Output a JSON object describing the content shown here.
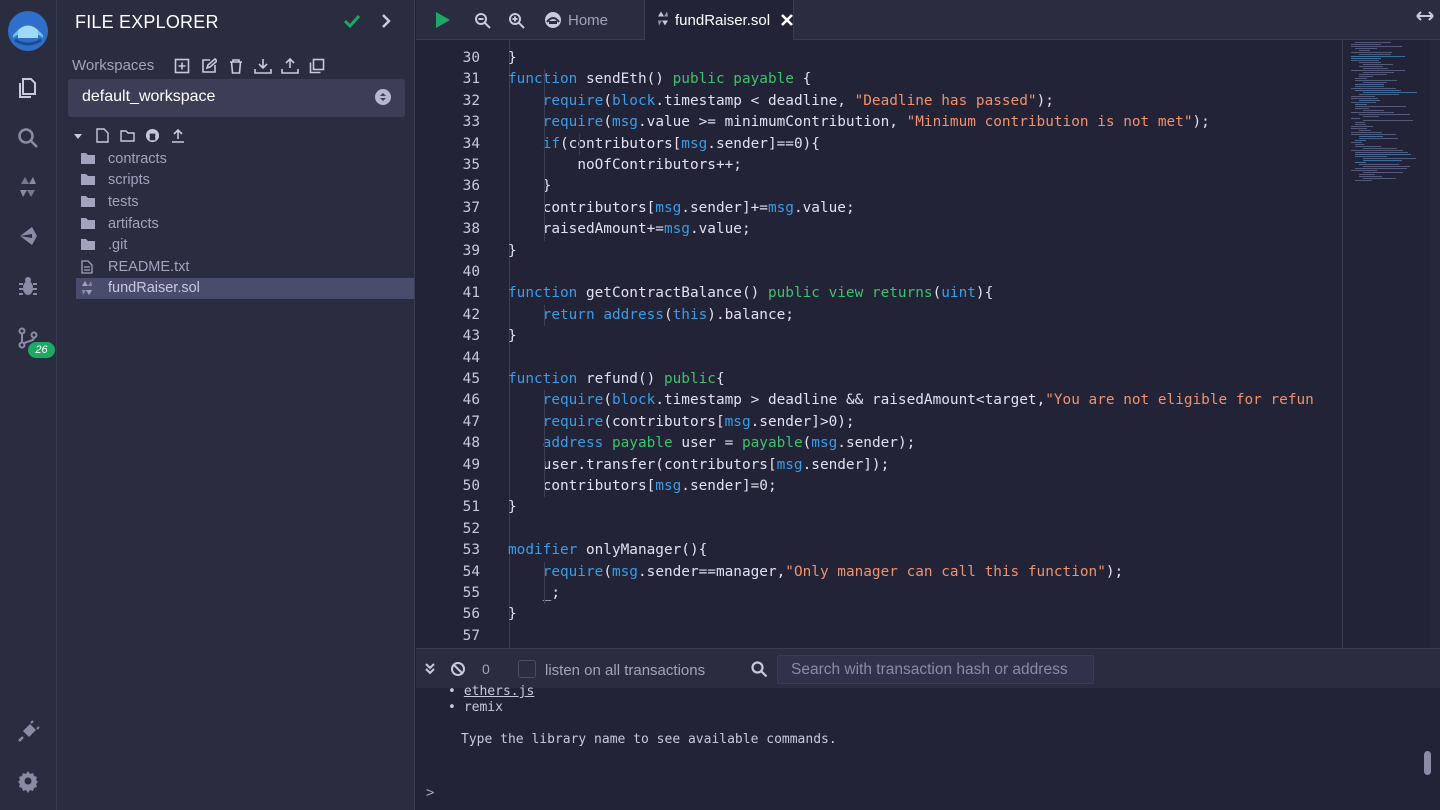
{
  "rail": {
    "items": [
      {
        "name": "file-explorer",
        "icon": "files-icon"
      },
      {
        "name": "search",
        "icon": "search-icon"
      },
      {
        "name": "solidity-compiler",
        "icon": "solidity-icon"
      },
      {
        "name": "deploy-run",
        "icon": "ethereum-icon"
      },
      {
        "name": "debugger",
        "icon": "bug-icon"
      },
      {
        "name": "git",
        "icon": "git-branch-icon"
      },
      {
        "name": "plugin-manager",
        "icon": "plug-icon"
      },
      {
        "name": "settings",
        "icon": "gear-icon"
      }
    ],
    "git_badge": "26"
  },
  "explorer": {
    "title": "FILE EXPLORER",
    "workspaces_label": "Workspaces",
    "workspace_selected": "default_workspace",
    "tree": [
      {
        "label": "contracts",
        "type": "folder"
      },
      {
        "label": "scripts",
        "type": "folder"
      },
      {
        "label": "tests",
        "type": "folder"
      },
      {
        "label": "artifacts",
        "type": "folder"
      },
      {
        "label": ".git",
        "type": "folder"
      },
      {
        "label": "README.txt",
        "type": "file"
      },
      {
        "label": "fundRaiser.sol",
        "type": "sol",
        "active": true
      }
    ]
  },
  "tabs": {
    "home": "Home",
    "file": "fundRaiser.sol"
  },
  "code": {
    "lines": [
      {
        "n": "30",
        "text": "    }"
      },
      {
        "n": "31",
        "text": "    function sendEth() public payable {"
      },
      {
        "n": "32",
        "text": "        require(block.timestamp < deadline, \"Deadline has passed\");"
      },
      {
        "n": "33",
        "text": "        require(msg.value >= minimumContribution, \"Minimum contribution is not met\");"
      },
      {
        "n": "34",
        "text": "        if(contributors[msg.sender]==0){"
      },
      {
        "n": "35",
        "text": "            noOfContributors++;"
      },
      {
        "n": "36",
        "text": "        }"
      },
      {
        "n": "37",
        "text": "        contributors[msg.sender]+=msg.value;"
      },
      {
        "n": "38",
        "text": "        raisedAmount+=msg.value;"
      },
      {
        "n": "39",
        "text": "    }"
      },
      {
        "n": "40",
        "text": ""
      },
      {
        "n": "41",
        "text": "    function getContractBalance() public view returns(uint){"
      },
      {
        "n": "42",
        "text": "        return address(this).balance;"
      },
      {
        "n": "43",
        "text": "    }"
      },
      {
        "n": "44",
        "text": ""
      },
      {
        "n": "45",
        "text": "    function refund() public{"
      },
      {
        "n": "46",
        "text": "        require(block.timestamp > deadline && raisedAmount<target,\"You are not eligible for refun"
      },
      {
        "n": "47",
        "text": "        require(contributors[msg.sender]>0);"
      },
      {
        "n": "48",
        "text": "        address payable user = payable(msg.sender);"
      },
      {
        "n": "49",
        "text": "        user.transfer(contributors[msg.sender]);"
      },
      {
        "n": "50",
        "text": "        contributors[msg.sender]=0;"
      },
      {
        "n": "51",
        "text": "    }"
      },
      {
        "n": "52",
        "text": ""
      },
      {
        "n": "53",
        "text": "    modifier onlyManager(){"
      },
      {
        "n": "54",
        "text": "        require(msg.sender==manager,\"Only manager can call this function\");"
      },
      {
        "n": "55",
        "text": "        _;"
      },
      {
        "n": "56",
        "text": "    }"
      },
      {
        "n": "57",
        "text": ""
      }
    ]
  },
  "terminal": {
    "pending_count": "0",
    "listen_label": "listen on all transactions",
    "search_placeholder": "Search with transaction hash or address",
    "libraries": [
      "ethers.js",
      "remix"
    ],
    "message": "Type the library name to see available commands.",
    "prompt": ">"
  },
  "colors": {
    "accent": "#1fa766",
    "play": "#1fa766",
    "keyword": "#3c9ce6",
    "string": "#f0926e",
    "builtin": "#3ec26b"
  }
}
